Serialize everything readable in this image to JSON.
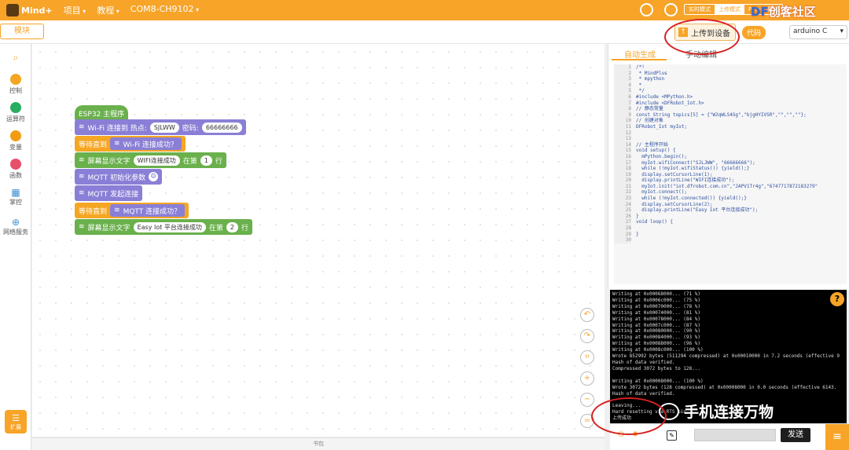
{
  "topbar": {
    "app_name": "Mind+",
    "menus": [
      "项目",
      "教程",
      "COM8-CH9102"
    ],
    "modes": [
      "实时模式",
      "上传模式",
      "Python模式"
    ],
    "brand": "DF创客社区",
    "brand_prefix": "DF",
    "brand_suffix": "创客社区"
  },
  "toolbar": {
    "modules_label": "模块",
    "upload_label": "上传到设备",
    "code_toggle_label": "代码",
    "board": "arduino C"
  },
  "sidebar": {
    "categories": [
      {
        "label": "控制",
        "color": "#f5a623"
      },
      {
        "label": "运算符",
        "color": "#27ae60"
      },
      {
        "label": "变量",
        "color": "#f39c12"
      },
      {
        "label": "函数",
        "color": "#e8506a"
      },
      {
        "label": "掌控",
        "color": "#3a8fd6"
      },
      {
        "label": "网络服务",
        "color": "#3a8fd6"
      }
    ],
    "extensions_label": "扩展"
  },
  "blocks": {
    "main": "ESP32 主程序",
    "wifi_connect": "Wi-Fi 连接到 热点:",
    "ssid": "SJLWW",
    "password_label": "密码:",
    "password": "66666666",
    "wait_until": "等待直到",
    "wifi_connected": "Wi-Fi 连接成功？",
    "screen_text": "屏幕显示文字",
    "wifi_success_text": "WIFI连接成功",
    "at_row": "在第",
    "row1": "1",
    "row_unit": "行",
    "mqtt_init": "MQTT 初始化参数",
    "mqtt_connect": "MQTT 发起连接",
    "mqtt_connected": "MQTT 连接成功？",
    "easy_iot_text": "Easy Iot 平台连接成功",
    "row2": "2"
  },
  "workspace": {
    "bottom_label": "书包"
  },
  "code_panel": {
    "tab_auto": "自动生成",
    "tab_manual": "手动编辑",
    "lines": [
      "/*!",
      " * MindPlus",
      " * mpython",
      " *",
      " */",
      "#include <MPython.h>",
      "#include <DFRobot_Iot.h>",
      "// 静态常量",
      "const String topics[5] = {\"W2qWLS4Sg\",\"bjgHYIVSR\",\"\",\"\",\"\"};",
      "// 创建对象",
      "DFRobot_Iot myIot;",
      "",
      "",
      "// 主程序开始",
      "void setup() {",
      "  mPython.begin();",
      "  myIot.wifiConnect(\"SJLJWW\", \"66666666\");",
      "  while (!myIot.wifiStatus()) {yield();}",
      "  display.setCursorLine(1);",
      "  display.printLine(\"WIFI连接成功\");",
      "  myIot.init(\"iot.dfrobot.com.cn\",\"JAPV1Tr4g\",\"6747717872183279\"",
      "  myIot.connect();",
      "  while (!myIot.connected()) {yield();}",
      "  display.setCursorLine(2);",
      "  display.printLine(\"Easy Iot 平台连接成功\");",
      "}",
      "void loop() {",
      "",
      "}",
      ""
    ]
  },
  "console": {
    "lines": [
      "Writing at 0x00068000... (71 %)",
      "Writing at 0x0006c000... (75 %)",
      "Writing at 0x00070000... (78 %)",
      "Writing at 0x00074000... (81 %)",
      "Writing at 0x00078000... (84 %)",
      "Writing at 0x0007c000... (87 %)",
      "Writing at 0x00080000... (90 %)",
      "Writing at 0x00084000... (93 %)",
      "Writing at 0x00088000... (96 %)",
      "Writing at 0x0008c000... (100 %)",
      "Wrote 852992 bytes (511294 compressed) at 0x00010000 in 7.2 seconds (effective 9",
      "Hash of data verified.",
      "Compressed 3072 bytes to 128...",
      "",
      "Writing at 0x00008000... (100 %)",
      "Wrote 3072 bytes (128 compressed) at 0x00008000 in 0.0 seconds (effective 6143.",
      "Hash of data verified.",
      "",
      "Leaving...",
      "Hard resetting via RTS pin...",
      "上传成功"
    ],
    "help_icon": "?",
    "send_label": "发送"
  },
  "watermark": "手机连接万物"
}
